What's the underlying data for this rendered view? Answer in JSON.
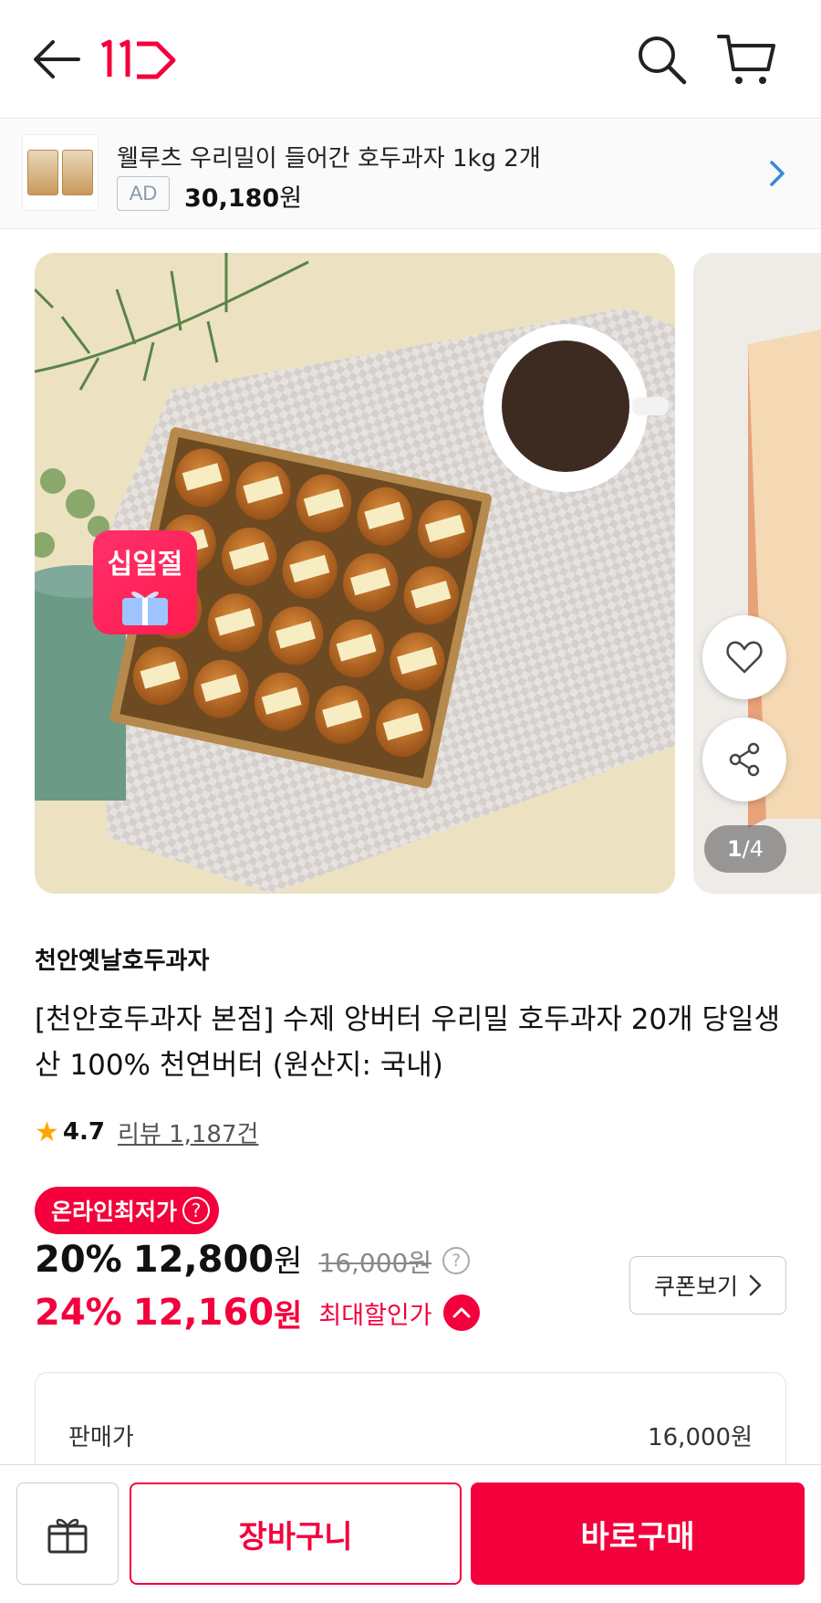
{
  "header": {
    "back_icon": "arrow-left-icon",
    "logo_text": "11",
    "search_icon": "search-icon",
    "cart_icon": "cart-icon",
    "brand_color": "#f4003c"
  },
  "ad": {
    "title": "웰루츠 우리밀이 들어간 호두과자 1kg 2개",
    "badge": "AD",
    "price_value": "30,180",
    "price_unit": "원",
    "arrow_icon": "chevron-right-icon"
  },
  "gallery": {
    "promo_badge": "십일절",
    "counter_current": "1",
    "counter_total": "/4",
    "like_icon": "heart-icon",
    "share_icon": "share-icon"
  },
  "product": {
    "seller": "천안옛날호두과자",
    "title": "[천안호두과자 본점] 수제 앙버터 우리밀 호두과자 20개 당일생산 100% 천연버터 (원산지: 국내)",
    "rating": "4.7",
    "review_label": "리뷰 1,187건"
  },
  "pricing": {
    "lowest_label": "온라인최저가",
    "discount_pct": "20%",
    "price": "12,800",
    "won": "원",
    "original_price": "16,000원",
    "max_pct": "24%",
    "max_price": "12,160",
    "max_label": "최대할인가",
    "coupon_label": "쿠폰보기",
    "sale_label": "판매가",
    "sale_amount": "16,000원"
  },
  "bottom": {
    "gift_icon": "gift-icon",
    "cart_label": "장바구니",
    "buy_label": "바로구매"
  }
}
